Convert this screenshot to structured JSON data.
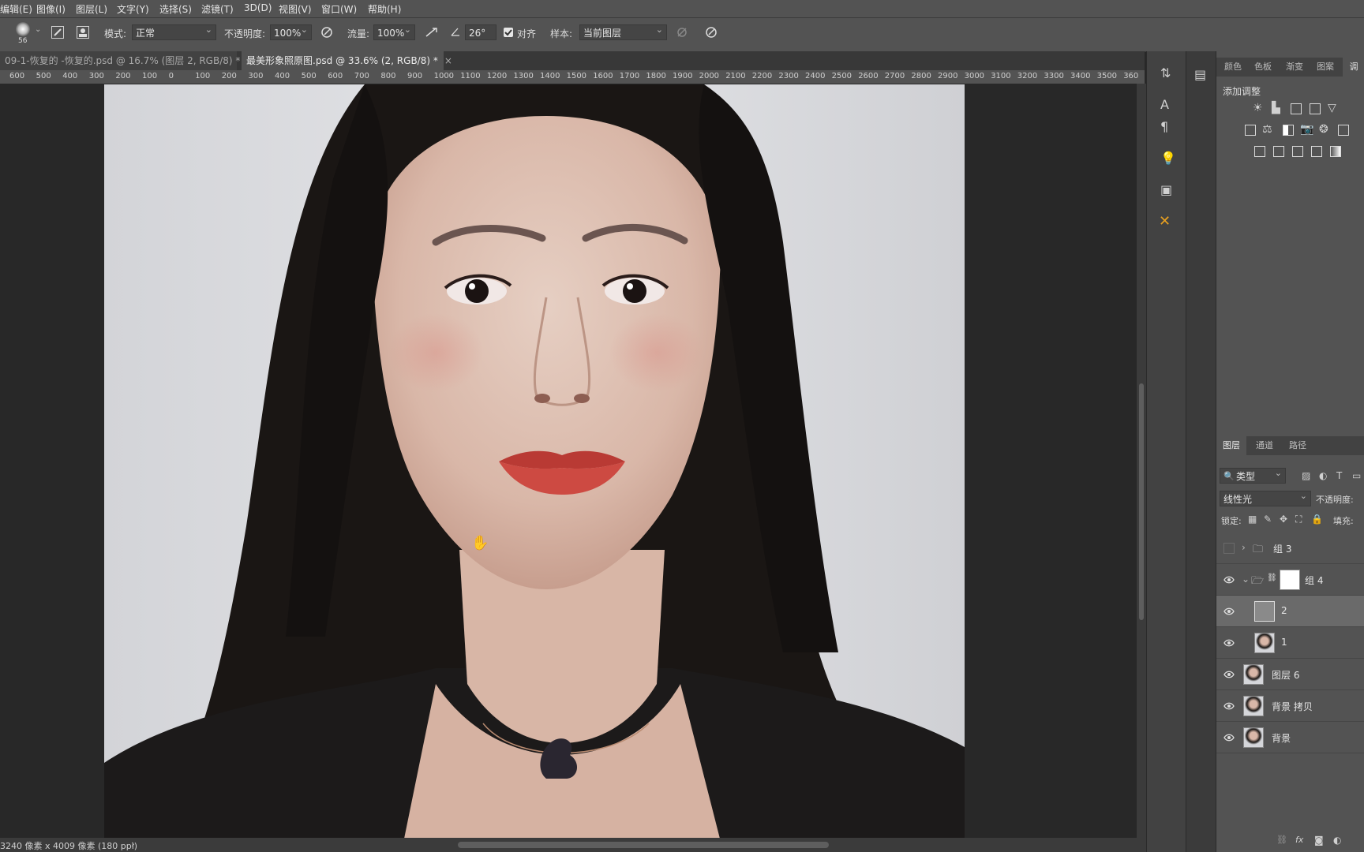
{
  "menu": [
    "编辑(E)",
    "图像(I)",
    "图层(L)",
    "文字(Y)",
    "选择(S)",
    "滤镜(T)",
    "3D(D)",
    "视图(V)",
    "窗口(W)",
    "帮助(H)"
  ],
  "options": {
    "brush_size": "56",
    "mode_label": "模式:",
    "mode_value": "正常",
    "opacity_label": "不透明度:",
    "opacity_value": "100%",
    "flow_label": "流量:",
    "flow_value": "100%",
    "angle_value": "26°",
    "align_label": "对齐",
    "align_checked": true,
    "sample_label": "样本:",
    "sample_value": "当前图层"
  },
  "tabs": [
    {
      "label": "09-1-恢复的 -恢复的.psd @ 16.7% (图层 2, RGB/8) *",
      "active": false
    },
    {
      "label": "最美形象照原图.psd @ 33.6% (2, RGB/8) *",
      "active": true
    }
  ],
  "tab_close": "×",
  "ruler": [
    "600",
    "500",
    "400",
    "300",
    "200",
    "100",
    "0",
    "100",
    "200",
    "300",
    "400",
    "500",
    "600",
    "700",
    "800",
    "900",
    "1000",
    "1100",
    "1200",
    "1300",
    "1400",
    "1500",
    "1600",
    "1700",
    "1800",
    "1900",
    "2000",
    "2100",
    "2200",
    "2300",
    "2400",
    "2500",
    "2600",
    "2700",
    "2800",
    "2900",
    "3000",
    "3100",
    "3200",
    "3300",
    "3400",
    "3500",
    "360"
  ],
  "status": {
    "doc_info": "3240 像素 x 4009 像素 (180 ppi)",
    "arrow": "›"
  },
  "adjust_panel": {
    "tabs": [
      "颜色",
      "色板",
      "渐变",
      "图案",
      "调"
    ],
    "title": "添加调整"
  },
  "layers_panel": {
    "tabs": [
      "图层",
      "通道",
      "路径"
    ],
    "filter_label": "类型",
    "blend_mode": "线性光",
    "opacity_label": "不透明度:",
    "lock_label": "锁定:",
    "fill_label": "填充:",
    "layers": [
      {
        "name": "组 3",
        "type": "group",
        "visible": false,
        "expanded": false
      },
      {
        "name": "组 4",
        "type": "group",
        "visible": true,
        "expanded": true
      },
      {
        "name": "2",
        "type": "layer",
        "visible": true,
        "selected": true
      },
      {
        "name": "1",
        "type": "layer",
        "visible": true
      },
      {
        "name": "图层 6",
        "type": "layer",
        "visible": true
      },
      {
        "name": "背景 拷贝",
        "type": "layer",
        "visible": true
      },
      {
        "name": "背景",
        "type": "layer",
        "visible": true
      }
    ]
  },
  "colors": {
    "ui_bg": "#535353",
    "canvas_bg": "#282828",
    "lips": "#c9473f",
    "photo_bg": "#d8d9dc"
  }
}
